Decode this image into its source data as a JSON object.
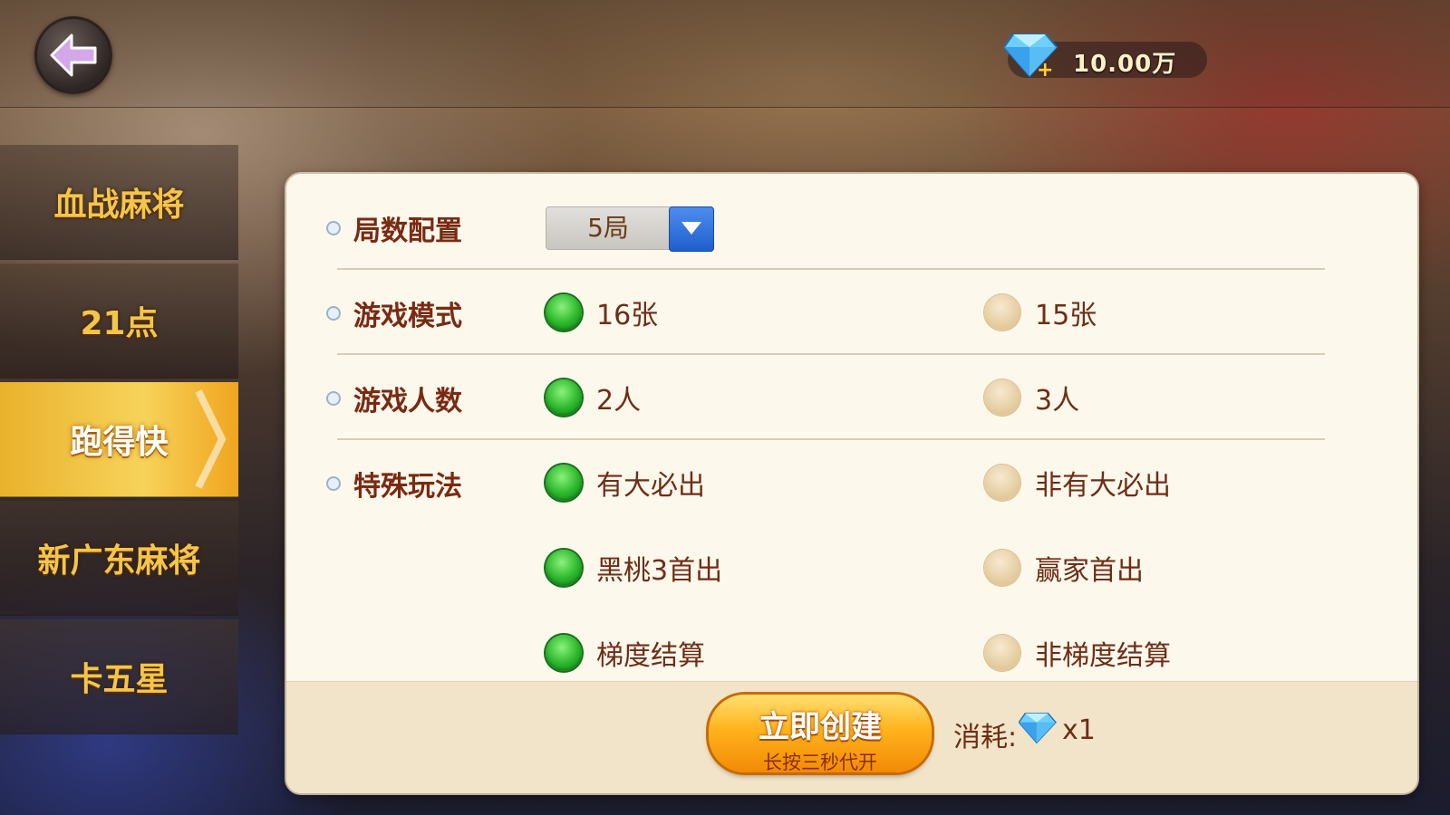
{
  "header": {
    "currency_value": "10.00万"
  },
  "sidebar": {
    "items": [
      {
        "label": "血战麻将"
      },
      {
        "label": "21点"
      },
      {
        "label": "跑得快"
      },
      {
        "label": "新广东麻将"
      },
      {
        "label": "卡五星"
      }
    ],
    "active": "跑得快"
  },
  "panel": {
    "rounds": {
      "label": "局数配置",
      "selected": "5局"
    },
    "mode": {
      "label": "游戏模式",
      "options": [
        "16张",
        "15张"
      ],
      "selected": "16张"
    },
    "players": {
      "label": "游戏人数",
      "options": [
        "2人",
        "3人"
      ],
      "selected": "2人"
    },
    "special": {
      "label": "特殊玩法",
      "rows": [
        {
          "options": [
            "有大必出",
            "非有大必出"
          ],
          "selected": "有大必出"
        },
        {
          "options": [
            "黑桃3首出",
            "赢家首出"
          ],
          "selected": "黑桃3首出"
        },
        {
          "options": [
            "梯度结算",
            "非梯度结算"
          ],
          "selected": "梯度结算"
        }
      ]
    }
  },
  "footer": {
    "create_label": "立即创建",
    "create_sublabel": "长按三秒代开",
    "cost_label": "消耗:",
    "cost_count": "x1"
  },
  "colors": {
    "accent_gold": "#f3c64a",
    "selected_green": "#29b52a",
    "label_brown": "#7a2a12",
    "panel_bg": "#fcf8ec"
  },
  "icons": [
    "back-arrow-icon",
    "diamond-icon",
    "dropdown-arrow-icon"
  ]
}
